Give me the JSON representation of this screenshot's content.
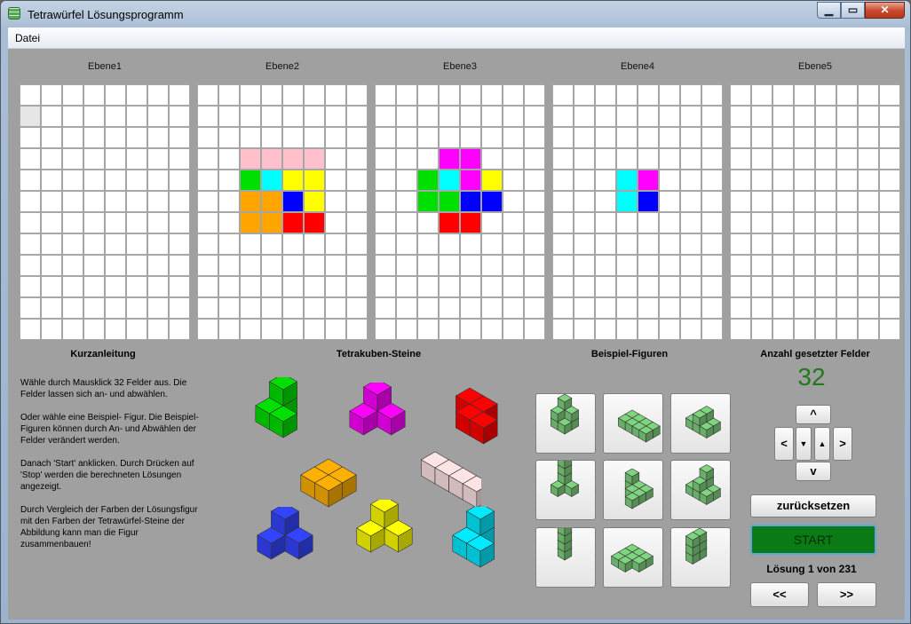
{
  "window": {
    "title": "Tetrawürfel Lösungsprogramm",
    "min": "▁",
    "max": "▭",
    "close": "✕"
  },
  "menu": {
    "datei": "Datei"
  },
  "levels": [
    {
      "label": "Ebene1",
      "cells": [
        {
          "r": 1,
          "c": 0,
          "color": "#e6e6e6"
        }
      ]
    },
    {
      "label": "Ebene2",
      "cells": [
        {
          "r": 3,
          "c": 2,
          "color": "#ffc0cb"
        },
        {
          "r": 3,
          "c": 3,
          "color": "#ffc0cb"
        },
        {
          "r": 3,
          "c": 4,
          "color": "#ffc0cb"
        },
        {
          "r": 3,
          "c": 5,
          "color": "#ffc0cb"
        },
        {
          "r": 4,
          "c": 2,
          "color": "#00e000"
        },
        {
          "r": 4,
          "c": 3,
          "color": "#00ffff"
        },
        {
          "r": 4,
          "c": 4,
          "color": "#ffff00"
        },
        {
          "r": 4,
          "c": 5,
          "color": "#ffff00"
        },
        {
          "r": 5,
          "c": 2,
          "color": "#ffa500"
        },
        {
          "r": 5,
          "c": 3,
          "color": "#ffa500"
        },
        {
          "r": 5,
          "c": 4,
          "color": "#0000ff"
        },
        {
          "r": 5,
          "c": 5,
          "color": "#ffff00"
        },
        {
          "r": 6,
          "c": 2,
          "color": "#ffa500"
        },
        {
          "r": 6,
          "c": 3,
          "color": "#ffa500"
        },
        {
          "r": 6,
          "c": 4,
          "color": "#ff0000"
        },
        {
          "r": 6,
          "c": 5,
          "color": "#ff0000"
        }
      ]
    },
    {
      "label": "Ebene3",
      "cells": [
        {
          "r": 3,
          "c": 3,
          "color": "#ff00ff"
        },
        {
          "r": 3,
          "c": 4,
          "color": "#ff00ff"
        },
        {
          "r": 4,
          "c": 2,
          "color": "#00e000"
        },
        {
          "r": 4,
          "c": 3,
          "color": "#00ffff"
        },
        {
          "r": 4,
          "c": 4,
          "color": "#ff00ff"
        },
        {
          "r": 4,
          "c": 5,
          "color": "#ffff00"
        },
        {
          "r": 5,
          "c": 2,
          "color": "#00e000"
        },
        {
          "r": 5,
          "c": 3,
          "color": "#00e000"
        },
        {
          "r": 5,
          "c": 4,
          "color": "#0000ff"
        },
        {
          "r": 5,
          "c": 5,
          "color": "#0000ff"
        },
        {
          "r": 6,
          "c": 3,
          "color": "#ff0000"
        },
        {
          "r": 6,
          "c": 4,
          "color": "#ff0000"
        }
      ]
    },
    {
      "label": "Ebene4",
      "cells": [
        {
          "r": 4,
          "c": 3,
          "color": "#00ffff"
        },
        {
          "r": 4,
          "c": 4,
          "color": "#ff00ff"
        },
        {
          "r": 5,
          "c": 3,
          "color": "#00ffff"
        },
        {
          "r": 5,
          "c": 4,
          "color": "#0000ff"
        }
      ]
    },
    {
      "label": "Ebene5",
      "cells": []
    }
  ],
  "grid": {
    "rows": 12,
    "cols": 8
  },
  "sections": {
    "kurzanleitung": "Kurzanleitung",
    "tetrakuben": "Tetrakuben-Steine",
    "beispiel": "Beispiel-Figuren",
    "anzahl": "Anzahl gesetzter Felder"
  },
  "instructions": [
    "Wähle durch Mausklick 32 Felder aus. Die Felder lassen sich an- und abwählen.",
    "Oder wähle eine Beispiel- Figur. Die Beispiel-Figuren können durch An- und Abwählen der Felder verändert werden.",
    "Danach 'Start' anklicken. Durch Drücken auf 'Stop' werden die berechneten Lösungen angezeigt.",
    "Durch Vergleich der Farben der Lösungsfigur mit den Farben der Tetrawürfel-Steine der Abbildung kann man die Figur zusammenbauen!"
  ],
  "tetracube_colors": [
    "#00e000",
    "#ff00ff",
    "#ff0000",
    "#ffb000",
    "#ffe4e6",
    "#3344ff",
    "#ffff00",
    "#00eaff"
  ],
  "figure_color": "#7fd47f",
  "count": "32",
  "nav": {
    "up": "^",
    "down": "v",
    "left": "<",
    "right": ">",
    "small_down": "▼",
    "small_up": "▲"
  },
  "buttons": {
    "reset": "zurücksetzen",
    "start": "START",
    "prev": "<<",
    "next": ">>"
  },
  "solution": "Lösung 1 von 231"
}
